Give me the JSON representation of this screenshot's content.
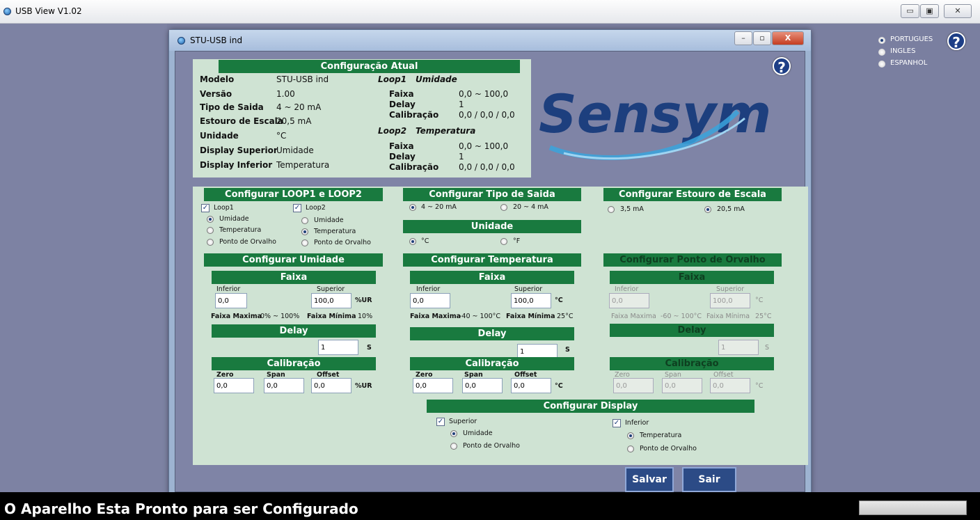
{
  "app": {
    "title": "USB View V1.02",
    "min": "▭",
    "max": "▣",
    "close": "✕"
  },
  "window": {
    "title": "STU-USB ind",
    "min": "–",
    "max": "▫",
    "close": "X"
  },
  "status": {
    "text": "O Aparelho Esta Pronto para ser Configurado"
  },
  "languages": {
    "pt": "PORTUGUES",
    "en": "INGLES",
    "es": "ESPANHOL",
    "selected": "PORTUGUES"
  },
  "help": "?",
  "logo": "Sensym",
  "atual": {
    "header": "Configuração Atual",
    "modelo_l": "Modelo",
    "modelo_v": "STU-USB ind",
    "versao_l": "Versão",
    "versao_v": "1.00",
    "saida_l": "Tipo de Saida",
    "saida_v": "4 ~ 20 mA",
    "estouro_l": "Estouro de Escala",
    "estouro_v": "20,5 mA",
    "unidade_l": "Unidade",
    "unidade_v": "°C",
    "dsup_l": "Display Superior",
    "dsup_v": "Umidade",
    "dinf_l": "Display Inferior",
    "dinf_v": "Temperatura",
    "loop1_l": "Loop1",
    "loop1_v": "Umidade",
    "loop2_l": "Loop2",
    "loop2_v": "Temperatura",
    "faixa_l": "Faixa",
    "delay_l": "Delay",
    "calib_l": "Calibração",
    "l1_faixa": "0,0 ~ 100,0",
    "l1_delay": "1",
    "l1_calib": "0,0 / 0,0 / 0,0",
    "l2_faixa": "0,0 ~ 100,0",
    "l2_delay": "1",
    "l2_calib": "0,0 / 0,0 / 0,0"
  },
  "loops": {
    "header": "Configurar LOOP1 e LOOP2",
    "loop1": "Loop1",
    "loop2": "Loop2",
    "umidade": "Umidade",
    "temperatura": "Temperatura",
    "orvalho": "Ponto de Orvalho"
  },
  "saida": {
    "header": "Configurar Tipo de Saida",
    "opt1": "4 ~ 20 mA",
    "opt2": "20 ~ 4 mA"
  },
  "estouro": {
    "header": "Configurar Estouro de Escala",
    "opt1": "3,5 mA",
    "opt2": "20,5 mA"
  },
  "unidade": {
    "header": "Unidade",
    "opt1": "°C",
    "opt2": "°F"
  },
  "umidade": {
    "header": "Configurar Umidade",
    "faixa": "Faixa",
    "inferior": "Inferior",
    "superior": "Superior",
    "inf_v": "0,0",
    "sup_v": "100,0",
    "unit": "%UR",
    "fmax_l": "Faixa Maxima",
    "fmax_v": "0% ~ 100%",
    "fmin_l": "Faixa Mínima",
    "fmin_v": "10%",
    "delay": "Delay",
    "delay_v": "1",
    "delay_u": "S",
    "calib": "Calibração",
    "zero": "Zero",
    "span": "Span",
    "offset": "Offset",
    "zero_v": "0,0",
    "span_v": "0,0",
    "offset_v": "0,0",
    "cal_unit": "%UR"
  },
  "temperatura": {
    "header": "Configurar Temperatura",
    "faixa": "Faixa",
    "inferior": "Inferior",
    "superior": "Superior",
    "inf_v": "0,0",
    "sup_v": "100,0",
    "unit": "°C",
    "fmax_l": "Faixa Maxima",
    "fmax_v": "-40 ~ 100°C",
    "fmin_l": "Faixa Mínima",
    "fmin_v": "25°C",
    "delay": "Delay",
    "delay_v": "1",
    "delay_u": "S",
    "calib": "Calibração",
    "zero": "Zero",
    "span": "Span",
    "offset": "Offset",
    "zero_v": "0,0",
    "span_v": "0,0",
    "offset_v": "0,0",
    "cal_unit": "°C"
  },
  "orvalho": {
    "header": "Configurar Ponto de Orvalho",
    "faixa": "Faixa",
    "inferior": "Inferior",
    "superior": "Superior",
    "inf_v": "0,0",
    "sup_v": "100,0",
    "unit": "°C",
    "fmax_l": "Faixa Maxima",
    "fmax_v": "-60 ~ 100°C",
    "fmin_l": "Faixa Mínima",
    "fmin_v": "25°C",
    "delay": "Delay",
    "delay_v": "1",
    "delay_u": "S",
    "calib": "Calibração",
    "zero": "Zero",
    "span": "Span",
    "offset": "Offset",
    "zero_v": "0,0",
    "span_v": "0,0",
    "offset_v": "0,0",
    "cal_unit": "°C"
  },
  "display": {
    "header": "Configurar Display",
    "superior": "Superior",
    "inferior": "Inferior",
    "umidade": "Umidade",
    "orvalho": "Ponto de Orvalho",
    "temperatura": "Temperatura"
  },
  "buttons": {
    "salvar": "Salvar",
    "sair": "Sair"
  }
}
